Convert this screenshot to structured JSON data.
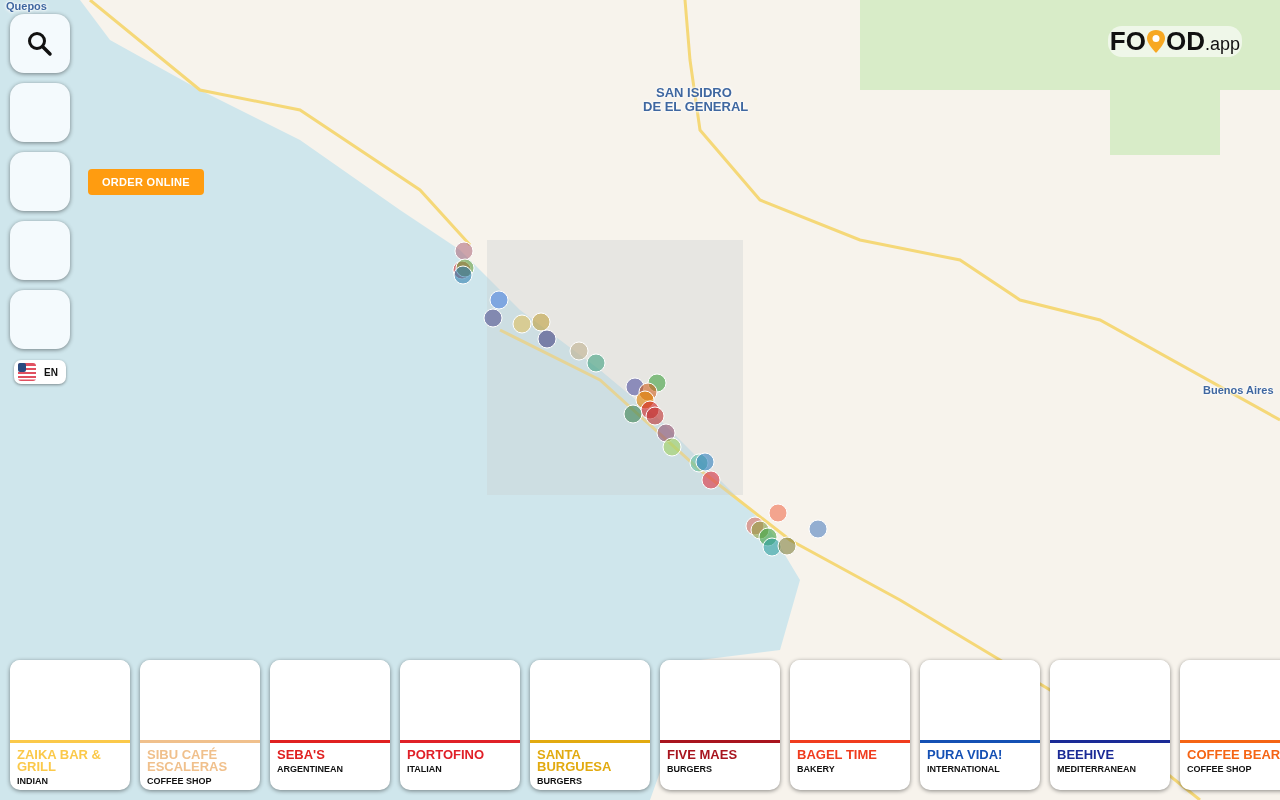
{
  "map": {
    "labels": [
      {
        "text": "Quepos",
        "kind": "town"
      },
      {
        "text": "SAN ISIDRO",
        "kind": "city"
      },
      {
        "text": "DE EL GENERAL",
        "kind": "city"
      },
      {
        "text": "Buenos Aires",
        "kind": "town"
      }
    ]
  },
  "logo": {
    "prefix": "FO",
    "suffix": "OD",
    "domain": ".app"
  },
  "tooltip": "ORDER ONLINE",
  "language": {
    "code": "EN"
  },
  "restaurants": [
    {
      "name": "ZAIKA BAR & GRILL",
      "category": "INDIAN",
      "color": "#fbc94a"
    },
    {
      "name": "SIBU CAFÉ ESCALERAS",
      "category": "COFFEE SHOP",
      "color": "#f0c08c"
    },
    {
      "name": "SEBA'S",
      "category": "ARGENTINEAN",
      "color": "#e02020"
    },
    {
      "name": "PORTOFINO",
      "category": "ITALIAN",
      "color": "#e02028"
    },
    {
      "name": "SANTA BURGUESA",
      "category": "BURGERS",
      "color": "#e2aa10"
    },
    {
      "name": "FIVE MAES",
      "category": "BURGERS",
      "color": "#a8141e"
    },
    {
      "name": "BAGEL TIME",
      "category": "BAKERY",
      "color": "#f03c1e"
    },
    {
      "name": "PURA VIDA!",
      "category": "INTERNATIONAL",
      "color": "#1450b4"
    },
    {
      "name": "BEEHIVE",
      "category": "MEDITERRANEAN",
      "color": "#1a2a96"
    },
    {
      "name": "COFFEE BEAR",
      "category": "COFFEE SHOP",
      "color": "#f56414"
    }
  ]
}
